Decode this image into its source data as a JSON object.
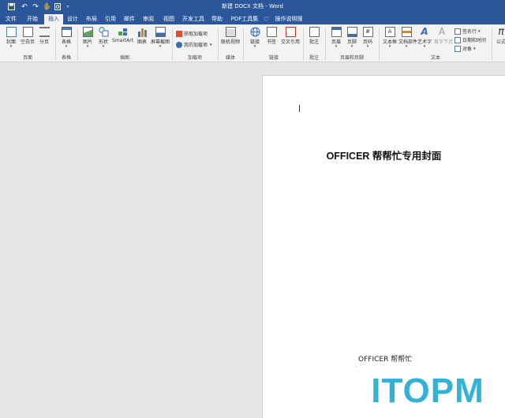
{
  "title_bar": {
    "title": "新建 DOCX 文档 - Word"
  },
  "quick_access": {
    "save_icon": "save-icon",
    "undo_icon": "undo-icon",
    "redo_icon": "redo-icon",
    "touch_icon": "touch-mode-icon",
    "print_preview_icon": "print-preview-icon",
    "customize_icon": "customize-icon"
  },
  "tabs": [
    "文件",
    "开始",
    "插入",
    "设计",
    "布局",
    "引用",
    "邮件",
    "审阅",
    "视图",
    "开发工具",
    "帮助",
    "PDF工具集"
  ],
  "active_tab": "插入",
  "tell_me": "操作说明搜索",
  "ribbon": {
    "pages": {
      "cover": "封面",
      "blank": "空白页",
      "break": "分页",
      "group": "页面"
    },
    "tables": {
      "table": "表格",
      "group": "表格"
    },
    "illustrations": {
      "picture": "图片",
      "shapes": "形状",
      "smartart": "SmartArt",
      "chart": "图表",
      "screenshot": "屏幕截图",
      "group": "插图"
    },
    "addins": {
      "get": "获取加载项",
      "my": "我的加载项",
      "group": "加载项"
    },
    "media": {
      "online_video": "联机视频",
      "group": "媒体"
    },
    "links": {
      "link": "链接",
      "bookmark": "书签",
      "cross_ref": "交叉引用",
      "group": "链接"
    },
    "comments": {
      "comment": "批注",
      "group": "批注"
    },
    "header_footer": {
      "header": "页眉",
      "footer": "页脚",
      "page_number": "页码",
      "group": "页眉和页脚"
    },
    "text": {
      "textbox": "文本框",
      "quick_parts": "文档部件",
      "wordart": "艺术字",
      "dropcap": "首字下沉",
      "signature": "签名行",
      "datetime": "日期和时间",
      "object": "对象",
      "group": "文本"
    },
    "symbols": {
      "equation": "公式"
    }
  },
  "document": {
    "heading": "OFFICER 帮帮忙专用封面",
    "footer_text": "OFFICER 帮帮忙",
    "watermark": "ITOPM"
  }
}
